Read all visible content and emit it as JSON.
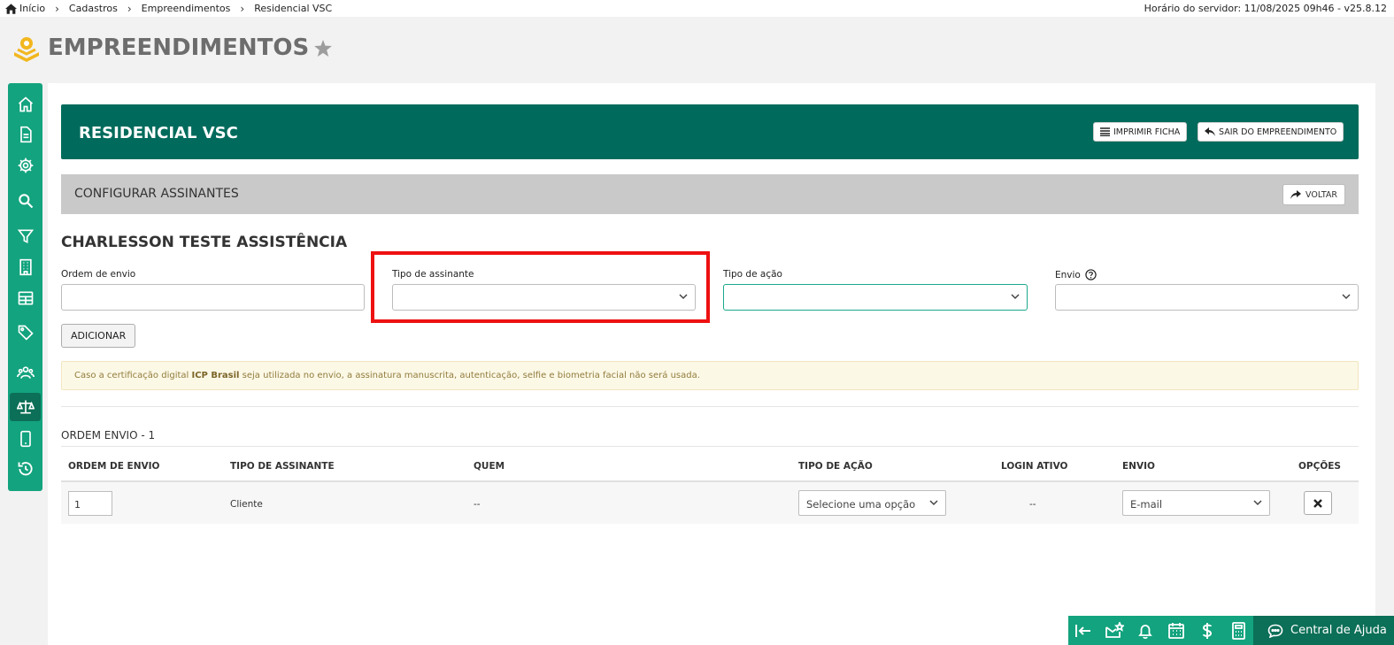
{
  "breadcrumb": [
    "Início",
    "Cadastros",
    "Empreendimentos",
    "Residencial VSC"
  ],
  "server_time": "Horário do servidor: 11/08/2025 09h46 - v25.8.12",
  "page_title": "EMPREENDIMENTOS",
  "sidebar_icons": [
    "home-icon",
    "document-icon",
    "gear-icon",
    "search-icon",
    "filter-icon",
    "building-icon",
    "table-icon",
    "tag-icon",
    "people-icon",
    "scale-icon",
    "mobile-icon",
    "history-icon"
  ],
  "sidebar_active": "scale-icon",
  "empreendimento": {
    "name": "RESIDENCIAL VSC",
    "print_label": "IMPRIMIR FICHA",
    "exit_label": "SAIR DO EMPREENDIMENTO"
  },
  "config": {
    "title": "CONFIGURAR ASSINANTES",
    "back_label": "VOLTAR"
  },
  "person_name": "CHARLESSON TESTE ASSISTÊNCIA",
  "form": {
    "ordem_label": "Ordem de envio",
    "ordem_value": "",
    "tipo_assinante_label": "Tipo de assinante",
    "tipo_assinante_value": "",
    "tipo_acao_label": "Tipo de ação",
    "tipo_acao_value": "",
    "envio_label": "Envio",
    "envio_value": "",
    "add_label": "ADICIONAR"
  },
  "alert": {
    "prefix": "Caso a certificação digital ",
    "bold": "ICP Brasil",
    "suffix": " seja utilizada no envio, a assinatura manuscrita, autenticação, selfie e biometria facial não será usada."
  },
  "group_title": "ORDEM ENVIO - 1",
  "table": {
    "headers": [
      "ORDEM DE ENVIO",
      "TIPO DE ASSINANTE",
      "QUEM",
      "TIPO DE AÇÃO",
      "LOGIN ATIVO",
      "ENVIO",
      "OPÇÕES"
    ],
    "rows": [
      {
        "ordem": "1",
        "tipo_assinante": "Cliente",
        "quem": "--",
        "tipo_acao": "Selecione uma opção",
        "login_ativo": "--",
        "envio": "E-mail"
      }
    ]
  },
  "colors": {
    "primary": "#13a37e",
    "header_dark": "#006b5c",
    "highlight": "#ee1111"
  },
  "help_label": "Central de Ajuda"
}
